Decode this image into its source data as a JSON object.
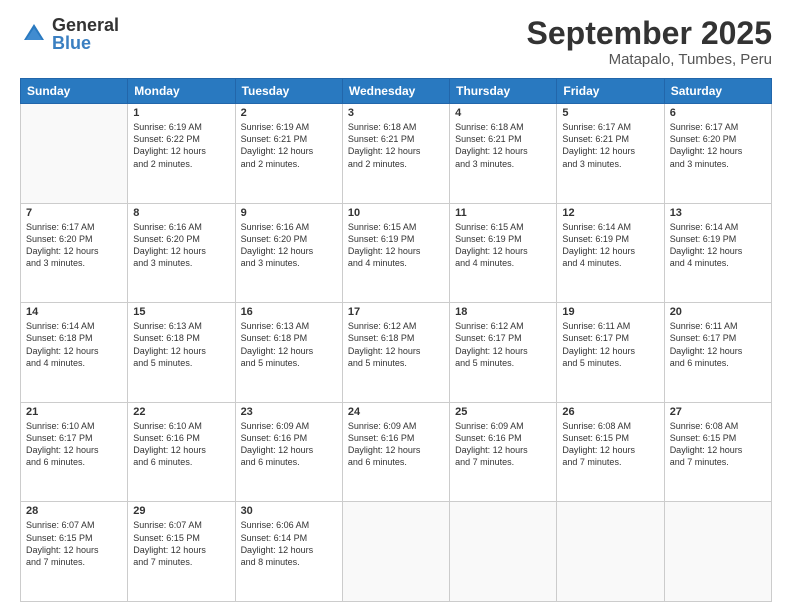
{
  "logo": {
    "general": "General",
    "blue": "Blue"
  },
  "title": "September 2025",
  "location": "Matapalo, Tumbes, Peru",
  "weekdays": [
    "Sunday",
    "Monday",
    "Tuesday",
    "Wednesday",
    "Thursday",
    "Friday",
    "Saturday"
  ],
  "weeks": [
    [
      {
        "day": "",
        "info": ""
      },
      {
        "day": "1",
        "info": "Sunrise: 6:19 AM\nSunset: 6:22 PM\nDaylight: 12 hours\nand 2 minutes."
      },
      {
        "day": "2",
        "info": "Sunrise: 6:19 AM\nSunset: 6:21 PM\nDaylight: 12 hours\nand 2 minutes."
      },
      {
        "day": "3",
        "info": "Sunrise: 6:18 AM\nSunset: 6:21 PM\nDaylight: 12 hours\nand 2 minutes."
      },
      {
        "day": "4",
        "info": "Sunrise: 6:18 AM\nSunset: 6:21 PM\nDaylight: 12 hours\nand 3 minutes."
      },
      {
        "day": "5",
        "info": "Sunrise: 6:17 AM\nSunset: 6:21 PM\nDaylight: 12 hours\nand 3 minutes."
      },
      {
        "day": "6",
        "info": "Sunrise: 6:17 AM\nSunset: 6:20 PM\nDaylight: 12 hours\nand 3 minutes."
      }
    ],
    [
      {
        "day": "7",
        "info": "Sunrise: 6:17 AM\nSunset: 6:20 PM\nDaylight: 12 hours\nand 3 minutes."
      },
      {
        "day": "8",
        "info": "Sunrise: 6:16 AM\nSunset: 6:20 PM\nDaylight: 12 hours\nand 3 minutes."
      },
      {
        "day": "9",
        "info": "Sunrise: 6:16 AM\nSunset: 6:20 PM\nDaylight: 12 hours\nand 3 minutes."
      },
      {
        "day": "10",
        "info": "Sunrise: 6:15 AM\nSunset: 6:19 PM\nDaylight: 12 hours\nand 4 minutes."
      },
      {
        "day": "11",
        "info": "Sunrise: 6:15 AM\nSunset: 6:19 PM\nDaylight: 12 hours\nand 4 minutes."
      },
      {
        "day": "12",
        "info": "Sunrise: 6:14 AM\nSunset: 6:19 PM\nDaylight: 12 hours\nand 4 minutes."
      },
      {
        "day": "13",
        "info": "Sunrise: 6:14 AM\nSunset: 6:19 PM\nDaylight: 12 hours\nand 4 minutes."
      }
    ],
    [
      {
        "day": "14",
        "info": "Sunrise: 6:14 AM\nSunset: 6:18 PM\nDaylight: 12 hours\nand 4 minutes."
      },
      {
        "day": "15",
        "info": "Sunrise: 6:13 AM\nSunset: 6:18 PM\nDaylight: 12 hours\nand 5 minutes."
      },
      {
        "day": "16",
        "info": "Sunrise: 6:13 AM\nSunset: 6:18 PM\nDaylight: 12 hours\nand 5 minutes."
      },
      {
        "day": "17",
        "info": "Sunrise: 6:12 AM\nSunset: 6:18 PM\nDaylight: 12 hours\nand 5 minutes."
      },
      {
        "day": "18",
        "info": "Sunrise: 6:12 AM\nSunset: 6:17 PM\nDaylight: 12 hours\nand 5 minutes."
      },
      {
        "day": "19",
        "info": "Sunrise: 6:11 AM\nSunset: 6:17 PM\nDaylight: 12 hours\nand 5 minutes."
      },
      {
        "day": "20",
        "info": "Sunrise: 6:11 AM\nSunset: 6:17 PM\nDaylight: 12 hours\nand 6 minutes."
      }
    ],
    [
      {
        "day": "21",
        "info": "Sunrise: 6:10 AM\nSunset: 6:17 PM\nDaylight: 12 hours\nand 6 minutes."
      },
      {
        "day": "22",
        "info": "Sunrise: 6:10 AM\nSunset: 6:16 PM\nDaylight: 12 hours\nand 6 minutes."
      },
      {
        "day": "23",
        "info": "Sunrise: 6:09 AM\nSunset: 6:16 PM\nDaylight: 12 hours\nand 6 minutes."
      },
      {
        "day": "24",
        "info": "Sunrise: 6:09 AM\nSunset: 6:16 PM\nDaylight: 12 hours\nand 6 minutes."
      },
      {
        "day": "25",
        "info": "Sunrise: 6:09 AM\nSunset: 6:16 PM\nDaylight: 12 hours\nand 7 minutes."
      },
      {
        "day": "26",
        "info": "Sunrise: 6:08 AM\nSunset: 6:15 PM\nDaylight: 12 hours\nand 7 minutes."
      },
      {
        "day": "27",
        "info": "Sunrise: 6:08 AM\nSunset: 6:15 PM\nDaylight: 12 hours\nand 7 minutes."
      }
    ],
    [
      {
        "day": "28",
        "info": "Sunrise: 6:07 AM\nSunset: 6:15 PM\nDaylight: 12 hours\nand 7 minutes."
      },
      {
        "day": "29",
        "info": "Sunrise: 6:07 AM\nSunset: 6:15 PM\nDaylight: 12 hours\nand 7 minutes."
      },
      {
        "day": "30",
        "info": "Sunrise: 6:06 AM\nSunset: 6:14 PM\nDaylight: 12 hours\nand 8 minutes."
      },
      {
        "day": "",
        "info": ""
      },
      {
        "day": "",
        "info": ""
      },
      {
        "day": "",
        "info": ""
      },
      {
        "day": "",
        "info": ""
      }
    ]
  ]
}
